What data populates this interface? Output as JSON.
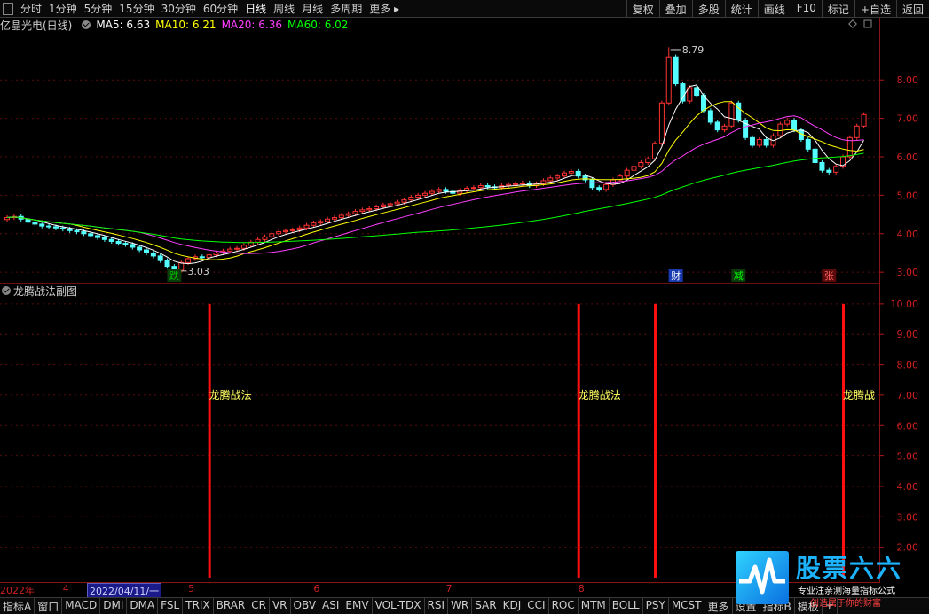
{
  "toolbar": {
    "periods": [
      "分时",
      "1分钟",
      "5分钟",
      "15分钟",
      "30分钟",
      "60分钟",
      "日线",
      "周线",
      "月线",
      "多周期",
      "更多 ▸"
    ],
    "active": "日线",
    "right": [
      "复权",
      "叠加",
      "多股",
      "统计",
      "画线",
      "F10",
      "标记",
      "+自选",
      "返回"
    ]
  },
  "main_legend": {
    "title": "亿晶光电(日线)",
    "items": [
      {
        "label": "MA5: 6.63",
        "color": "#ffffff"
      },
      {
        "label": "MA10: 6.21",
        "color": "#ffff00"
      },
      {
        "label": "MA20: 6.36",
        "color": "#ff40ff"
      },
      {
        "label": "MA60: 6.02",
        "color": "#00ff00"
      }
    ]
  },
  "sub_legend": {
    "title": "龙腾战法副图"
  },
  "chart_data": [
    {
      "type": "candlestick",
      "title": "亿晶光电(日线)",
      "ylim": [
        2.75,
        9.25
      ],
      "yticks": [
        "8.00",
        "7.00",
        "6.00",
        "5.00",
        "4.00",
        "3.00"
      ],
      "grid": true,
      "close": [
        4.42,
        4.45,
        4.38,
        4.3,
        4.25,
        4.2,
        4.18,
        4.15,
        4.12,
        4.08,
        4.05,
        4.0,
        3.95,
        3.9,
        3.85,
        3.8,
        3.75,
        3.72,
        3.65,
        3.58,
        3.5,
        3.42,
        3.3,
        3.15,
        3.05,
        3.25,
        3.35,
        3.4,
        3.38,
        3.45,
        3.5,
        3.55,
        3.6,
        3.62,
        3.7,
        3.78,
        3.85,
        3.92,
        4.0,
        4.05,
        4.08,
        4.1,
        4.15,
        4.22,
        4.28,
        4.32,
        4.38,
        4.42,
        4.48,
        4.52,
        4.58,
        4.62,
        4.65,
        4.7,
        4.75,
        4.78,
        4.82,
        4.88,
        4.95,
        5.0,
        5.05,
        5.1,
        5.15,
        5.1,
        5.05,
        5.12,
        5.18,
        5.2,
        5.25,
        5.22,
        5.2,
        5.25,
        5.28,
        5.3,
        5.32,
        5.25,
        5.3,
        5.38,
        5.45,
        5.5,
        5.58,
        5.62,
        5.5,
        5.4,
        5.2,
        5.15,
        5.28,
        5.4,
        5.5,
        5.65,
        5.75,
        5.85,
        5.95,
        6.35,
        7.4,
        8.6,
        7.9,
        7.45,
        7.8,
        7.6,
        7.2,
        6.9,
        6.7,
        6.8,
        7.4,
        6.95,
        6.5,
        6.3,
        6.45,
        6.3,
        6.55,
        6.85,
        6.95,
        6.7,
        6.45,
        6.2,
        5.85,
        5.65,
        5.6,
        5.75,
        6.0,
        6.5,
        6.8,
        7.1
      ],
      "annotations": [
        {
          "text": "3.03",
          "index": 24,
          "value": 3.03
        },
        {
          "text": "8.79",
          "index": 95,
          "value": 8.79
        }
      ],
      "markers": [
        {
          "text": "跌",
          "index": 24,
          "color": "#00c000",
          "bg": "#0a3a0a"
        },
        {
          "text": "财",
          "index": 96,
          "color": "#ffffff",
          "bg": "#1a3ab0"
        },
        {
          "text": "减",
          "index": 105,
          "color": "#00ff00",
          "bg": "#0a3a0a"
        },
        {
          "text": "张",
          "index": 118,
          "color": "#ff6060",
          "bg": "#5a0a0a"
        }
      ],
      "series": [
        {
          "name": "MA5",
          "color": "#ffffff"
        },
        {
          "name": "MA10",
          "color": "#ffff00"
        },
        {
          "name": "MA20",
          "color": "#ff40ff"
        },
        {
          "name": "MA60",
          "color": "#00ff00"
        }
      ]
    },
    {
      "type": "bar",
      "title": "龙腾战法副图",
      "ylim": [
        1.0,
        10.2
      ],
      "yticks": [
        "10.00",
        "9.00",
        "8.00",
        "7.00",
        "6.00",
        "5.00",
        "4.00",
        "3.00",
        "2.00"
      ],
      "grid": true,
      "signals": [
        {
          "index": 29,
          "value": 10,
          "label": "龙腾战法"
        },
        {
          "index": 82,
          "value": 10,
          "label": "龙腾战法"
        },
        {
          "index": 93,
          "value": 10,
          "label": ""
        },
        {
          "index": 120,
          "value": 10,
          "label": "龙腾战"
        }
      ]
    }
  ],
  "date_axis": {
    "labels": [
      {
        "text": "2022年",
        "index": 0
      },
      {
        "text": "4",
        "index": 8
      },
      {
        "text": "5",
        "index": 26
      },
      {
        "text": "6",
        "index": 44
      },
      {
        "text": "7",
        "index": 63
      },
      {
        "text": "8",
        "index": 82
      }
    ],
    "cursor": "2022/04/11/一"
  },
  "indicator_tabs": [
    "指标A",
    "窗口",
    "MACD",
    "DMI",
    "DMA",
    "FSL",
    "TRIX",
    "BRAR",
    "CR",
    "VR",
    "OBV",
    "ASI",
    "EMV",
    "VOL-TDX",
    "RSI",
    "WR",
    "SAR",
    "KDJ",
    "CCI",
    "ROC",
    "MTM",
    "BOLL",
    "PSY",
    "MCST",
    "更多",
    "设置",
    "指标B",
    "模板",
    "+"
  ],
  "watermark": {
    "name": "股票六六",
    "slogan": "专业注亲测海量指标公式",
    "slogan2": "创造属于你的财富"
  }
}
